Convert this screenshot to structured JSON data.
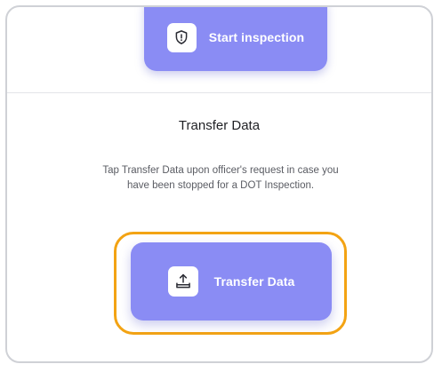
{
  "start_inspection": {
    "label": "Start inspection",
    "icon": "shield-alert-icon"
  },
  "transfer_section": {
    "title": "Transfer Data",
    "description": "Tap Transfer Data upon officer's  request in case you have been stopped for a DOT Inspection.",
    "button_label": "Transfer Data",
    "button_icon": "upload-tray-icon"
  },
  "colors": {
    "button_bg": "#8a8cf4",
    "highlight_border": "#f3a313",
    "frame_border": "#cfd1d6"
  }
}
